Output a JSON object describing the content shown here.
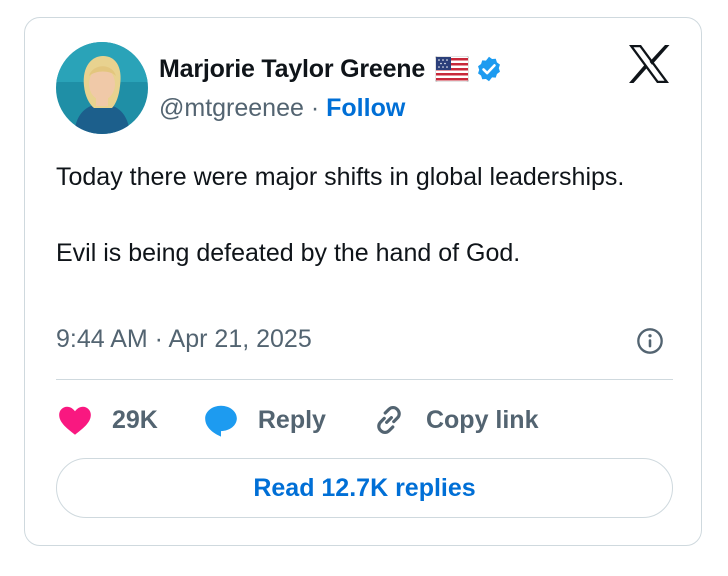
{
  "author": {
    "name": "Marjorie Taylor Greene",
    "handle": "@mtgreenee",
    "separator": "·",
    "follow_label": "Follow",
    "flag_icon": "us-flag-icon",
    "verified_icon": "verified-badge-icon",
    "verified_color": "#1d9bf0"
  },
  "tweet": {
    "paragraphs": [
      "Today there were major shifts in global leaderships.",
      "Evil is being defeated by the hand of God."
    ],
    "timestamp": "9:44 AM · Apr 21, 2025"
  },
  "actions": {
    "like_count": "29K",
    "like_color": "#f91880",
    "reply_label": "Reply",
    "reply_color": "#1d9bf0",
    "copy_label": "Copy link"
  },
  "footer": {
    "read_replies_label": "Read 12.7K replies"
  },
  "brand": {
    "logo_icon": "x-logo-icon",
    "accent": "#006fd6"
  }
}
